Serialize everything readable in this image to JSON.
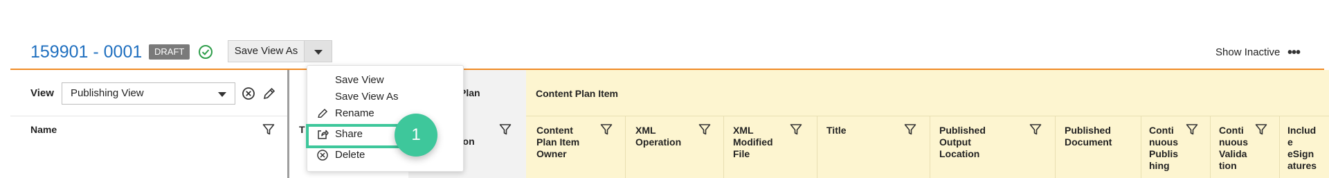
{
  "header": {
    "record_id": "159901 - 0001",
    "status_badge": "DRAFT",
    "save_view_as": "Save View As",
    "show_inactive": "Show Inactive"
  },
  "left_panel": {
    "view_label": "View",
    "view_value": "Publishing View",
    "name_header": "Name",
    "t_header": "T"
  },
  "partial_columns": {
    "plan_text": "Plan",
    "tion_text": "tion"
  },
  "content_plan_item": {
    "title": "Content Plan Item",
    "columns": [
      {
        "label": [
          "Content",
          "Plan Item",
          "Owner"
        ],
        "filter": true
      },
      {
        "label": [
          "XML",
          "Operation"
        ],
        "filter": true
      },
      {
        "label": [
          "XML",
          "Modified",
          "File"
        ],
        "filter": true
      },
      {
        "label": [
          "Title"
        ],
        "filter": true
      },
      {
        "label": [
          "Published",
          "Output",
          "Location"
        ],
        "filter": true
      },
      {
        "label": [
          "Published",
          "Document"
        ],
        "filter": false
      },
      {
        "label": [
          "Conti",
          "nuous",
          "Publis",
          "hing"
        ],
        "filter": true
      },
      {
        "label": [
          "Conti",
          "nuous",
          "Valida",
          "tion"
        ],
        "filter": true
      },
      {
        "label": [
          "Includ",
          "e",
          "eSign",
          "atures"
        ],
        "filter": false
      }
    ]
  },
  "menu": {
    "items": [
      {
        "label": "Save View",
        "icon": ""
      },
      {
        "label": "Save View As",
        "icon": ""
      },
      {
        "label": "Rename",
        "icon": "pencil-icon"
      },
      {
        "label": "Share",
        "icon": "share-icon"
      },
      {
        "label": "Delete",
        "icon": "delete-circle-icon"
      }
    ]
  },
  "annotation": {
    "step_number": "1"
  },
  "colors": {
    "accent_orange": "#f08a24",
    "link_blue": "#1f6fbf",
    "highlight_green": "#3ec79b",
    "band_yellow": "#fdf5d0"
  }
}
